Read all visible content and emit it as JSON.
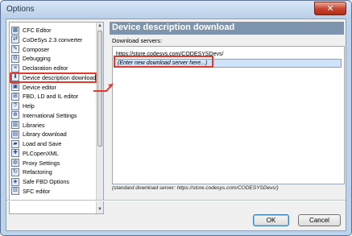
{
  "window": {
    "title": "Options",
    "close_label": "✕"
  },
  "sidebar": {
    "items": [
      {
        "label": "CFC Editor",
        "icon": "cfc-editor-icon",
        "glyph": "▦"
      },
      {
        "label": "CoDeSys 2.3 converter",
        "icon": "converter-icon",
        "glyph": "⇄"
      },
      {
        "label": "Composer",
        "icon": "composer-icon",
        "glyph": "✎"
      },
      {
        "label": "Debugging",
        "icon": "debugging-icon",
        "glyph": "⚙"
      },
      {
        "label": "Declaration editor",
        "icon": "declaration-editor-icon",
        "glyph": "≡"
      },
      {
        "label": "Device description download",
        "icon": "device-download-icon",
        "glyph": "⬇",
        "selected": true
      },
      {
        "label": "Device editor",
        "icon": "device-editor-icon",
        "glyph": "▣"
      },
      {
        "label": "FBD, LD and IL editor",
        "icon": "fbd-editor-icon",
        "glyph": "⊞"
      },
      {
        "label": "Help",
        "icon": "help-icon",
        "glyph": "?"
      },
      {
        "label": "International Settings",
        "icon": "international-settings-icon",
        "glyph": "⊕"
      },
      {
        "label": "Libraries",
        "icon": "libraries-icon",
        "glyph": "▥"
      },
      {
        "label": "Library download",
        "icon": "library-download-icon",
        "glyph": "▤"
      },
      {
        "label": "Load and Save",
        "icon": "load-save-icon",
        "glyph": "▰"
      },
      {
        "label": "PLCopenXML",
        "icon": "plcopenxml-icon",
        "glyph": "✚"
      },
      {
        "label": "Proxy Settings",
        "icon": "proxy-settings-icon",
        "glyph": "◍"
      },
      {
        "label": "Refactoring",
        "icon": "refactoring-icon",
        "glyph": "↻"
      },
      {
        "label": "Safe FBD Options",
        "icon": "safe-fbd-icon",
        "glyph": "◈"
      },
      {
        "label": "SFC editor",
        "icon": "sfc-editor-icon",
        "glyph": "⊟"
      }
    ]
  },
  "panel": {
    "title": "Device description download",
    "servers_label": "Download servers:",
    "servers": [
      "https://store.codesys.com/CODESYSDevs/",
      "(Enter new download server here...)"
    ],
    "footnote": "(standard download server: https://store.codesys.com/CODESYSDevs/)"
  },
  "buttons": {
    "ok": "OK",
    "cancel": "Cancel"
  },
  "colors": {
    "annotation_red": "#e23b2e",
    "header": "#7e94ad"
  }
}
